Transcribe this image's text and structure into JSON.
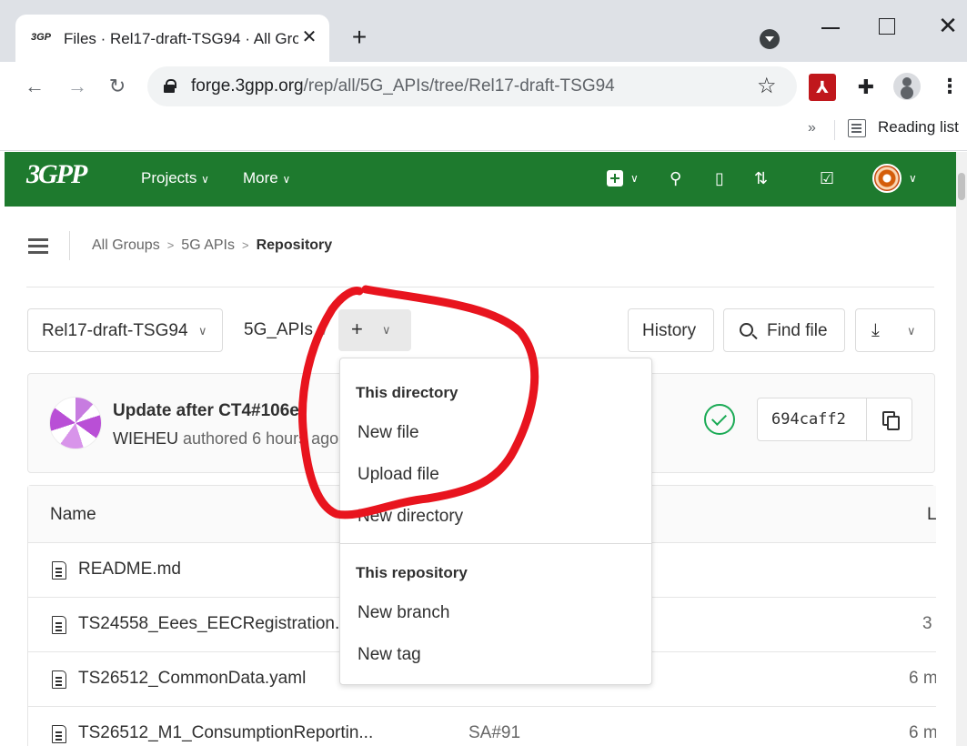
{
  "browser": {
    "tab_title": "Files · Rel17-draft-TSG94 · All Gro",
    "tab_close": "✕",
    "new_tab": "+",
    "url_host": "forge.3gpp.org",
    "url_path": "/rep/all/5G_APIs/tree/Rel17-draft-TSG94",
    "bookmarks_overflow": "»",
    "reading_list": "Reading list",
    "window_close": "✕"
  },
  "gitlab_header": {
    "logo": "3GPP",
    "nav": [
      {
        "label": "Projects"
      },
      {
        "label": "More"
      }
    ]
  },
  "breadcrumb": {
    "items": [
      "All Groups",
      "5G APIs"
    ],
    "current": "Repository"
  },
  "repo_controls": {
    "branch": "Rel17-draft-TSG94",
    "path": "5G_APIs",
    "path_sep": "/",
    "add_label": "+",
    "history": "History",
    "find_file": "Find file"
  },
  "commit": {
    "title": "Update after CT4#106e",
    "author": "WIEHEU",
    "meta_suffix": "authored 6 hours ago",
    "sha": "694caff2",
    "status": "passed",
    "status_color": "#1aaa55"
  },
  "add_menu": {
    "directory_header": "This directory",
    "directory_items": [
      "New file",
      "Upload file",
      "New directory"
    ],
    "repository_header": "This repository",
    "repository_items": [
      "New branch",
      "New tag"
    ]
  },
  "file_table": {
    "headers": {
      "name": "Name",
      "last_update": "L"
    },
    "rows": [
      {
        "name": "README.md",
        "message": "",
        "time": ""
      },
      {
        "name": "TS24558_Eees_EECRegistration.yaml",
        "message": "",
        "time": "3"
      },
      {
        "name": "TS26512_CommonData.yaml",
        "message": "",
        "time": "6 m"
      },
      {
        "name": "TS26512_M1_ConsumptionReportin...",
        "message": "SA#91",
        "time": "6 m"
      }
    ]
  },
  "colors": {
    "header_green": "#1e7a2e",
    "annotation_red": "#e8141e"
  }
}
